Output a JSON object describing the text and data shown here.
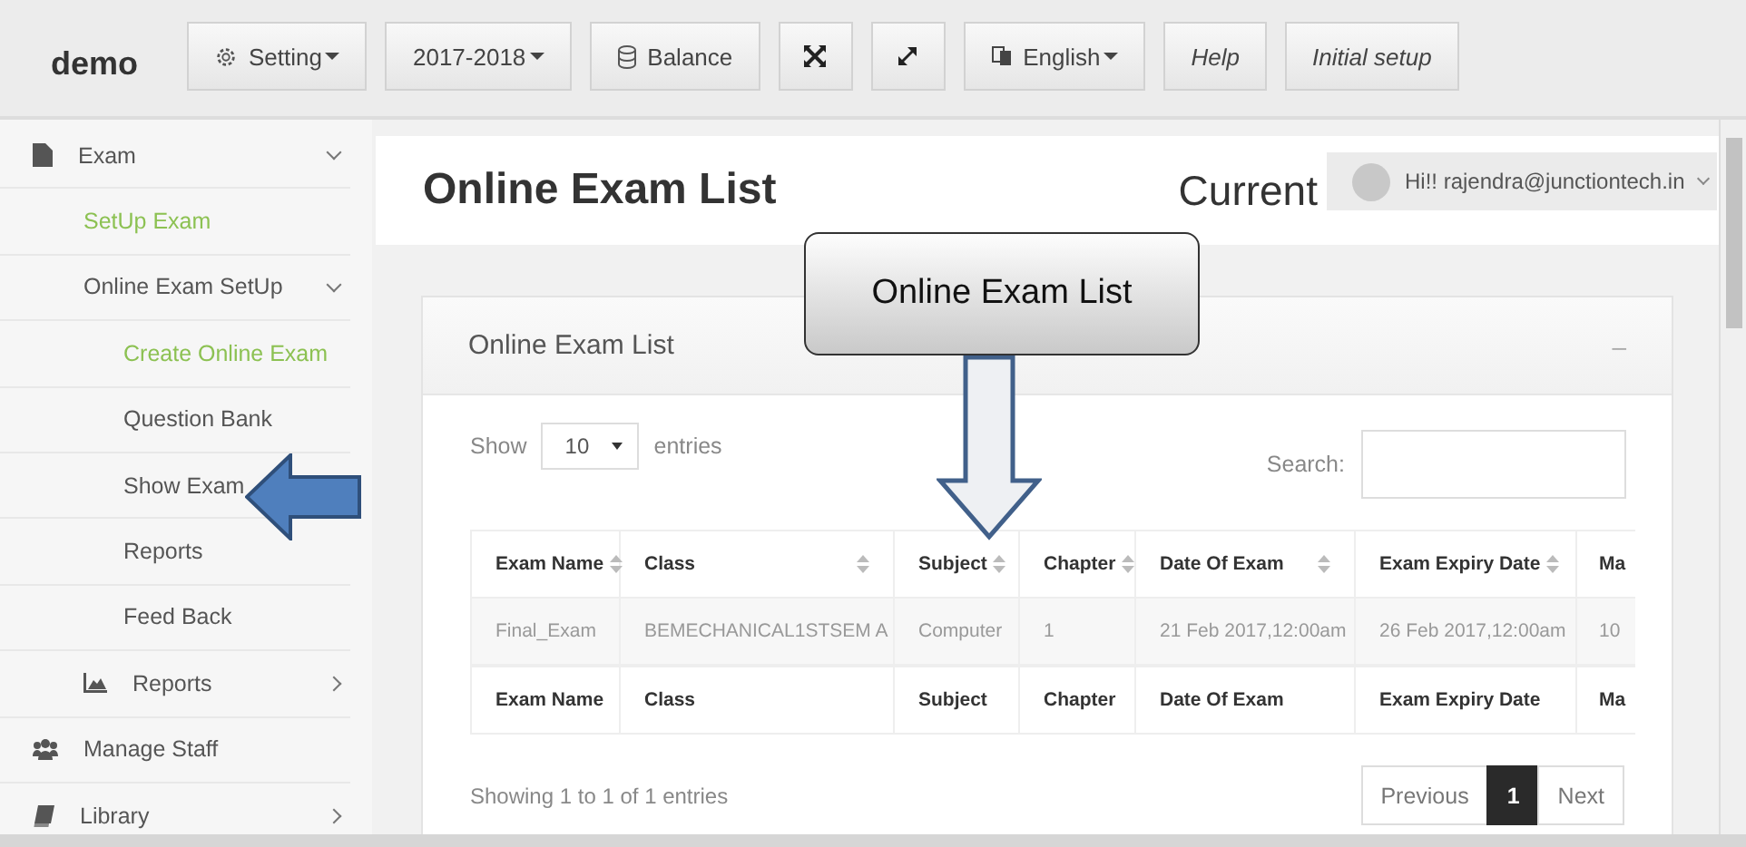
{
  "topbar": {
    "brand": "demo",
    "buttons": [
      {
        "kind": "dropdown",
        "label": "Setting"
      },
      {
        "kind": "dropdown",
        "label": "2017-2018"
      },
      {
        "kind": "plain",
        "label": "Balance"
      },
      {
        "kind": "icon"
      },
      {
        "kind": "icon"
      },
      {
        "kind": "dropdown",
        "label": "English"
      },
      {
        "kind": "italic",
        "label": "Help"
      },
      {
        "kind": "italic",
        "label": "Initial setup"
      }
    ]
  },
  "sidebar": {
    "items": [
      {
        "label": "Exam",
        "expanded": true,
        "children": [
          {
            "label": "SetUp Exam",
            "selected": true
          },
          {
            "label": "Online Exam SetUp",
            "expanded": true,
            "children": [
              {
                "label": "Create Online Exam",
                "selected": true
              },
              {
                "label": "Question Bank",
                "selected": false
              },
              {
                "label": "Show Exam",
                "selected": false
              },
              {
                "label": "Reports",
                "selected": false
              },
              {
                "label": "Feed Back",
                "selected": false
              }
            ]
          },
          {
            "label": "Reports",
            "expanded": false
          }
        ]
      },
      {
        "label": "Manage Staff",
        "selected": false
      },
      {
        "label": "Library",
        "expanded": false
      }
    ]
  },
  "header": {
    "title": "Online Exam List",
    "side_text": "Current",
    "user": "Hi!! rajendra@junctiontech.in"
  },
  "card": {
    "title": "Online Exam List",
    "collapse_symbol": "–",
    "length": {
      "before": "Show",
      "value": "10",
      "after": "entries"
    },
    "search_label": "Search:",
    "table": {
      "columns": [
        {
          "label": "Exam Name",
          "sortable": true
        },
        {
          "label": "Class",
          "sortable": true
        },
        {
          "label": "Subject",
          "sortable": true
        },
        {
          "label": "Chapter",
          "sortable": true
        },
        {
          "label": "Date Of Exam",
          "sortable": true
        },
        {
          "label": "Exam Expiry Date",
          "sortable": true
        },
        {
          "label": "Ma"
        }
      ],
      "rows": [
        [
          "Final_Exam",
          "BEMECHANICAL1STSEM A",
          "Computer",
          "1",
          "21 Feb 2017,12:00am",
          "26 Feb 2017,12:00am",
          "10"
        ]
      ],
      "footer": [
        "Exam Name",
        "Class",
        "Subject",
        "Chapter",
        "Date Of Exam",
        "Exam Expiry Date",
        "Ma"
      ]
    },
    "info": "Showing 1 to 1 of 1 entries",
    "pagination": [
      {
        "label": "Previous",
        "selected": false
      },
      {
        "label": "1",
        "selected": true
      },
      {
        "label": "Next",
        "selected": false
      }
    ]
  },
  "annotations": {
    "callout": "Online Exam List"
  }
}
